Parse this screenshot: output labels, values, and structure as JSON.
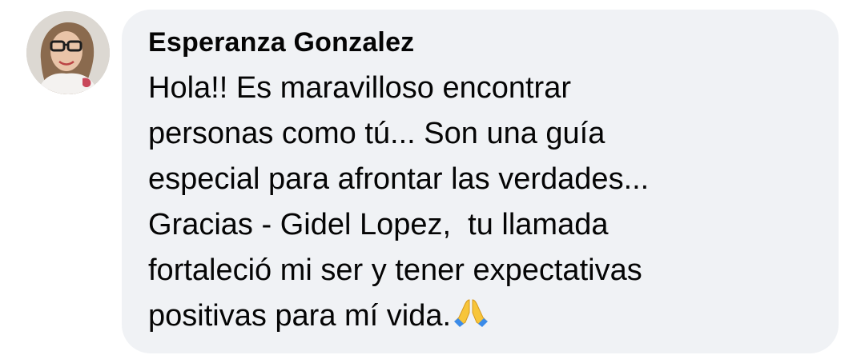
{
  "comment": {
    "author": "Esperanza Gonzalez",
    "text_lines": [
      "Hola!! Es maravilloso encontrar",
      "personas como tú... Son una guía",
      "especial para afrontar las verdades...",
      "Gracias - Gidel Lopez,  tu llamada",
      "fortaleció mi ser y tener expectativas",
      "positivas para mí vida."
    ],
    "trailing_emoji": "folded-hands-icon"
  },
  "colors": {
    "bubble_background": "#f0f2f5",
    "text": "#050505",
    "emoji_yellow": "#f7c53a",
    "emoji_sleeve": "#3b8be8"
  }
}
